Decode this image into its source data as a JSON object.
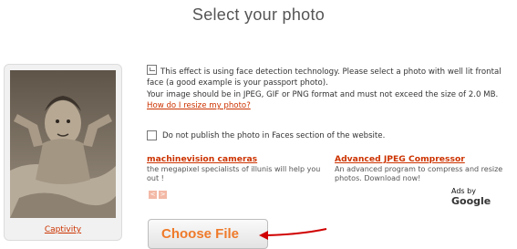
{
  "page": {
    "title": "Select your photo"
  },
  "thumbnail": {
    "caption": "Captivity"
  },
  "info": {
    "line1": "This effect is using face detection technology. Please select a photo with well lit frontal face (a good example is your passport photo).",
    "line2": "Your image should be in JPEG, GIF or PNG format and must not exceed the size of 2.0 MB.",
    "link": "How do I resize my photo?"
  },
  "optout": {
    "label": "Do not publish the photo in Faces section of the website."
  },
  "ads": [
    {
      "title": "machinevision cameras",
      "text": "the megapixel specialists of illunis will help you out !"
    },
    {
      "title": "Advanced JPEG Compressor",
      "text": "An advanced program to compress and resize photos. Download now!"
    }
  ],
  "ads_by": {
    "prefix": "Ads by",
    "brand": "Google"
  },
  "upload": {
    "button_label": "Choose File"
  },
  "colors": {
    "accent": "#cc3300",
    "button_text": "#ef7a2a",
    "arrow": "#d00000"
  }
}
